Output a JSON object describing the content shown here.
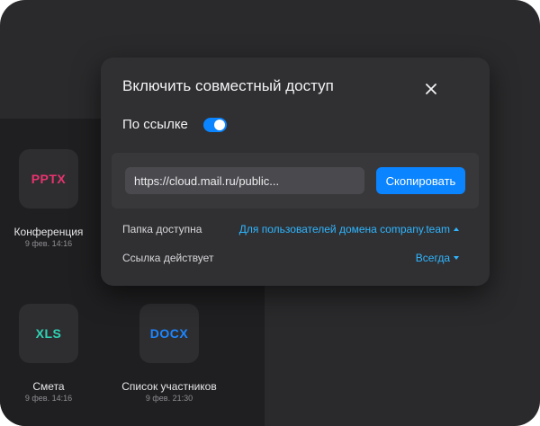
{
  "dialog": {
    "title": "Включить совместный доступ",
    "close_icon": "close-icon",
    "toggle": {
      "label": "По ссылке",
      "on": true
    },
    "link": {
      "value": "https://cloud.mail.ru/public...",
      "copy_label": "Скопировать"
    },
    "folder_access": {
      "label": "Папка доступна",
      "value": "Для пользователей домена company.team"
    },
    "link_validity": {
      "label": "Ссылка действует",
      "value": "Всегда"
    }
  },
  "files": [
    {
      "ext": "PPTX",
      "name": "Конференция",
      "date": "9 фев. 14:16",
      "color": "#e8336e"
    },
    {
      "ext": "XLS",
      "name": "Смета",
      "date": "9 фев. 14:16",
      "color": "#2fd3b4"
    },
    {
      "ext": "DOCX",
      "name": "Список участников",
      "date": "9 фев. 21:30",
      "color": "#1d86ff"
    }
  ],
  "colors": {
    "accent": "#0a84ff",
    "link": "#2fb6ff",
    "background": "#2a2a2c",
    "dialog": "#303033"
  }
}
